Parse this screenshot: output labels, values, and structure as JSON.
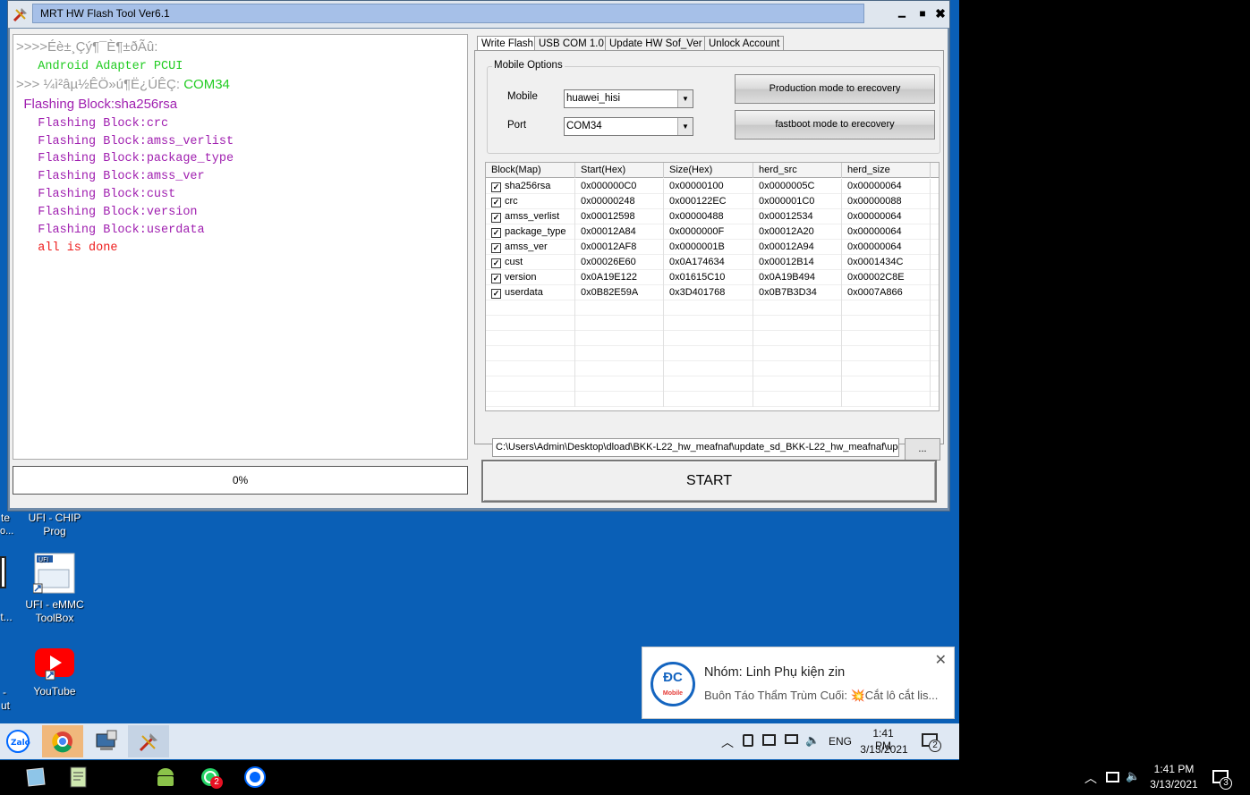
{
  "window": {
    "title": "MRT HW Flash Tool Ver6.1",
    "minimize": "▁",
    "maximize": "■",
    "close": "✖"
  },
  "log": {
    "line1": ">>>>Éè±¸Çý¶¯È¶±ðÃû:",
    "line2": "   Android Adapter PCUI",
    "line3a": ">>> ¼ì²âµ½ÊÖ»ú¶Ë¿ÚÊÇ: ",
    "line3b": "COM34",
    "line4": "  Flashing Block:sha256rsa",
    "lines": [
      "   Flashing Block:crc",
      "   Flashing Block:amss_verlist",
      "   Flashing Block:package_type",
      "   Flashing Block:amss_ver",
      "   Flashing Block:cust",
      "   Flashing Block:version",
      "   Flashing Block:userdata"
    ],
    "done": "   all is done",
    "colors": {
      "gray": "#9a9a9a",
      "green": "#22cc22",
      "purple": "#a020b0",
      "red": "#ee1c1c"
    }
  },
  "progress": {
    "percent": 0,
    "label": "0%"
  },
  "tabs": [
    "Write Flash",
    "USB COM 1.0",
    "Update HW Sof_Ver",
    "Unlock Account"
  ],
  "mobile_options": {
    "title": "Mobile Options",
    "mobile_label": "Mobile",
    "mobile_value": "huawei_hisi",
    "port_label": "Port",
    "port_value": "COM34",
    "btn_production": "Production mode to erecovery",
    "btn_fastboot": "fastboot mode to erecovery"
  },
  "grid": {
    "headers": [
      "Block(Map)",
      "Start(Hex)",
      "Size(Hex)",
      "herd_src",
      "herd_size"
    ],
    "rows": [
      [
        "sha256rsa",
        "0x000000C0",
        "0x00000100",
        "0x0000005C",
        "0x00000064"
      ],
      [
        "crc",
        "0x00000248",
        "0x000122EC",
        "0x000001C0",
        "0x00000088"
      ],
      [
        "amss_verlist",
        "0x00012598",
        "0x00000488",
        "0x00012534",
        "0x00000064"
      ],
      [
        "package_type",
        "0x00012A84",
        "0x0000000F",
        "0x00012A20",
        "0x00000064"
      ],
      [
        "amss_ver",
        "0x00012AF8",
        "0x0000001B",
        "0x00012A94",
        "0x00000064"
      ],
      [
        "cust",
        "0x00026E60",
        "0x0A174634",
        "0x00012B14",
        "0x0001434C"
      ],
      [
        "version",
        "0x0A19E122",
        "0x01615C10",
        "0x0A19B494",
        "0x00002C8E"
      ],
      [
        "userdata",
        "0x0B82E59A",
        "0x3D401768",
        "0x0B7B3D34",
        "0x0007A866"
      ]
    ],
    "check": "✓"
  },
  "path": "C:\\Users\\Admin\\Desktop\\dload\\BKK-L22_hw_meafnaf\\update_sd_BKK-L22_hw_meafnaf\\upd",
  "browse": "...",
  "start": "START",
  "desktop": {
    "icon1": "UFI - CHIP\nProg",
    "icon2": "UFI - eMMC\nToolBox",
    "icon3": "YouTube",
    "edge": [
      "te",
      "o...",
      "t...",
      "-",
      "ut"
    ]
  },
  "toast": {
    "logo": "ĐC",
    "logo_sub": "Mobile",
    "title": "Nhóm: Linh Phụ kiện zin",
    "body": "Buôn Táo Thẩm Trùm Cuối: 💥Cắt lô cắt lis...",
    "close": "✕"
  },
  "remote_tray": {
    "lang": "ENG",
    "time": "1:41 PM",
    "date": "3/13/2021",
    "notif": "2"
  },
  "host_tray": {
    "time": "1:41 PM",
    "date": "3/13/2021",
    "notif": "3",
    "whatsapp_badge": "2"
  }
}
